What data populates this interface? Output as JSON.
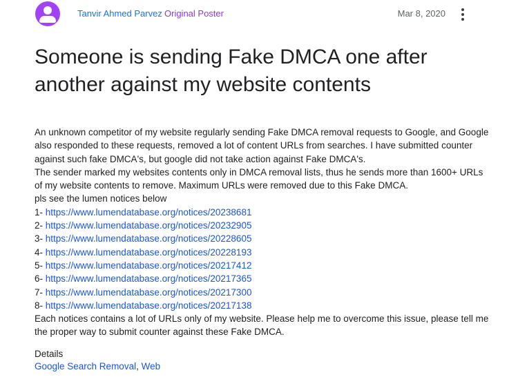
{
  "post": {
    "author": "Tanvir Ahmed Parvez",
    "badge": "Original Poster",
    "date": "Mar 8, 2020",
    "title": "Someone is sending Fake DMCA one after another against my website contents",
    "paragraph1": "An unknown competitor of my website regularly sending Fake DMCA removal requests to Google, and Google also responded to these requests, removed a lot of content URLs from searches. I have submitted counter against such fake DMCA's, but google did not take action against Fake DMCA's.",
    "paragraph2": "The sender marked my websites contents only in DMCA removal lists, thus he sends more than 1600+ URLs of my website contents to remove. Maximum URLs were removed due to this Fake DMCA.",
    "paragraph3": "pls see the lumen notices below",
    "notices": [
      {
        "prefix": "1- ",
        "url": "https://www.lumendatabase.org/notices/20238681"
      },
      {
        "prefix": "2- ",
        "url": "https://www.lumendatabase.org/notices/20232905"
      },
      {
        "prefix": "3- ",
        "url": "https://www.lumendatabase.org/notices/20228605"
      },
      {
        "prefix": "4- ",
        "url": "https://www.lumendatabase.org/notices/20228193"
      },
      {
        "prefix": "5- ",
        "url": "https://www.lumendatabase.org/notices/20217412"
      },
      {
        "prefix": "6- ",
        "url": "https://www.lumendatabase.org/notices/20217365"
      },
      {
        "prefix": "7- ",
        "url": "https://www.lumendatabase.org/notices/20217300"
      },
      {
        "prefix": "8- ",
        "url": "https://www.lumendatabase.org/notices/20217138"
      }
    ],
    "paragraph4": "Each notices contains a lot of URLs only of my website. Please help me to overcome this issue, please tell me the proper way to submit counter against these Fake DMCA."
  },
  "details": {
    "label": "Details",
    "category": "Google Search Removal",
    "separator": ", ",
    "subcategory": "Web"
  },
  "icons": {
    "avatar": "person-avatar-icon",
    "more": "more-vert-icon"
  },
  "colors": {
    "avatar": "#a142f4",
    "author": "#1a73e8",
    "badge": "#9334e6",
    "link": "#1a56db"
  }
}
